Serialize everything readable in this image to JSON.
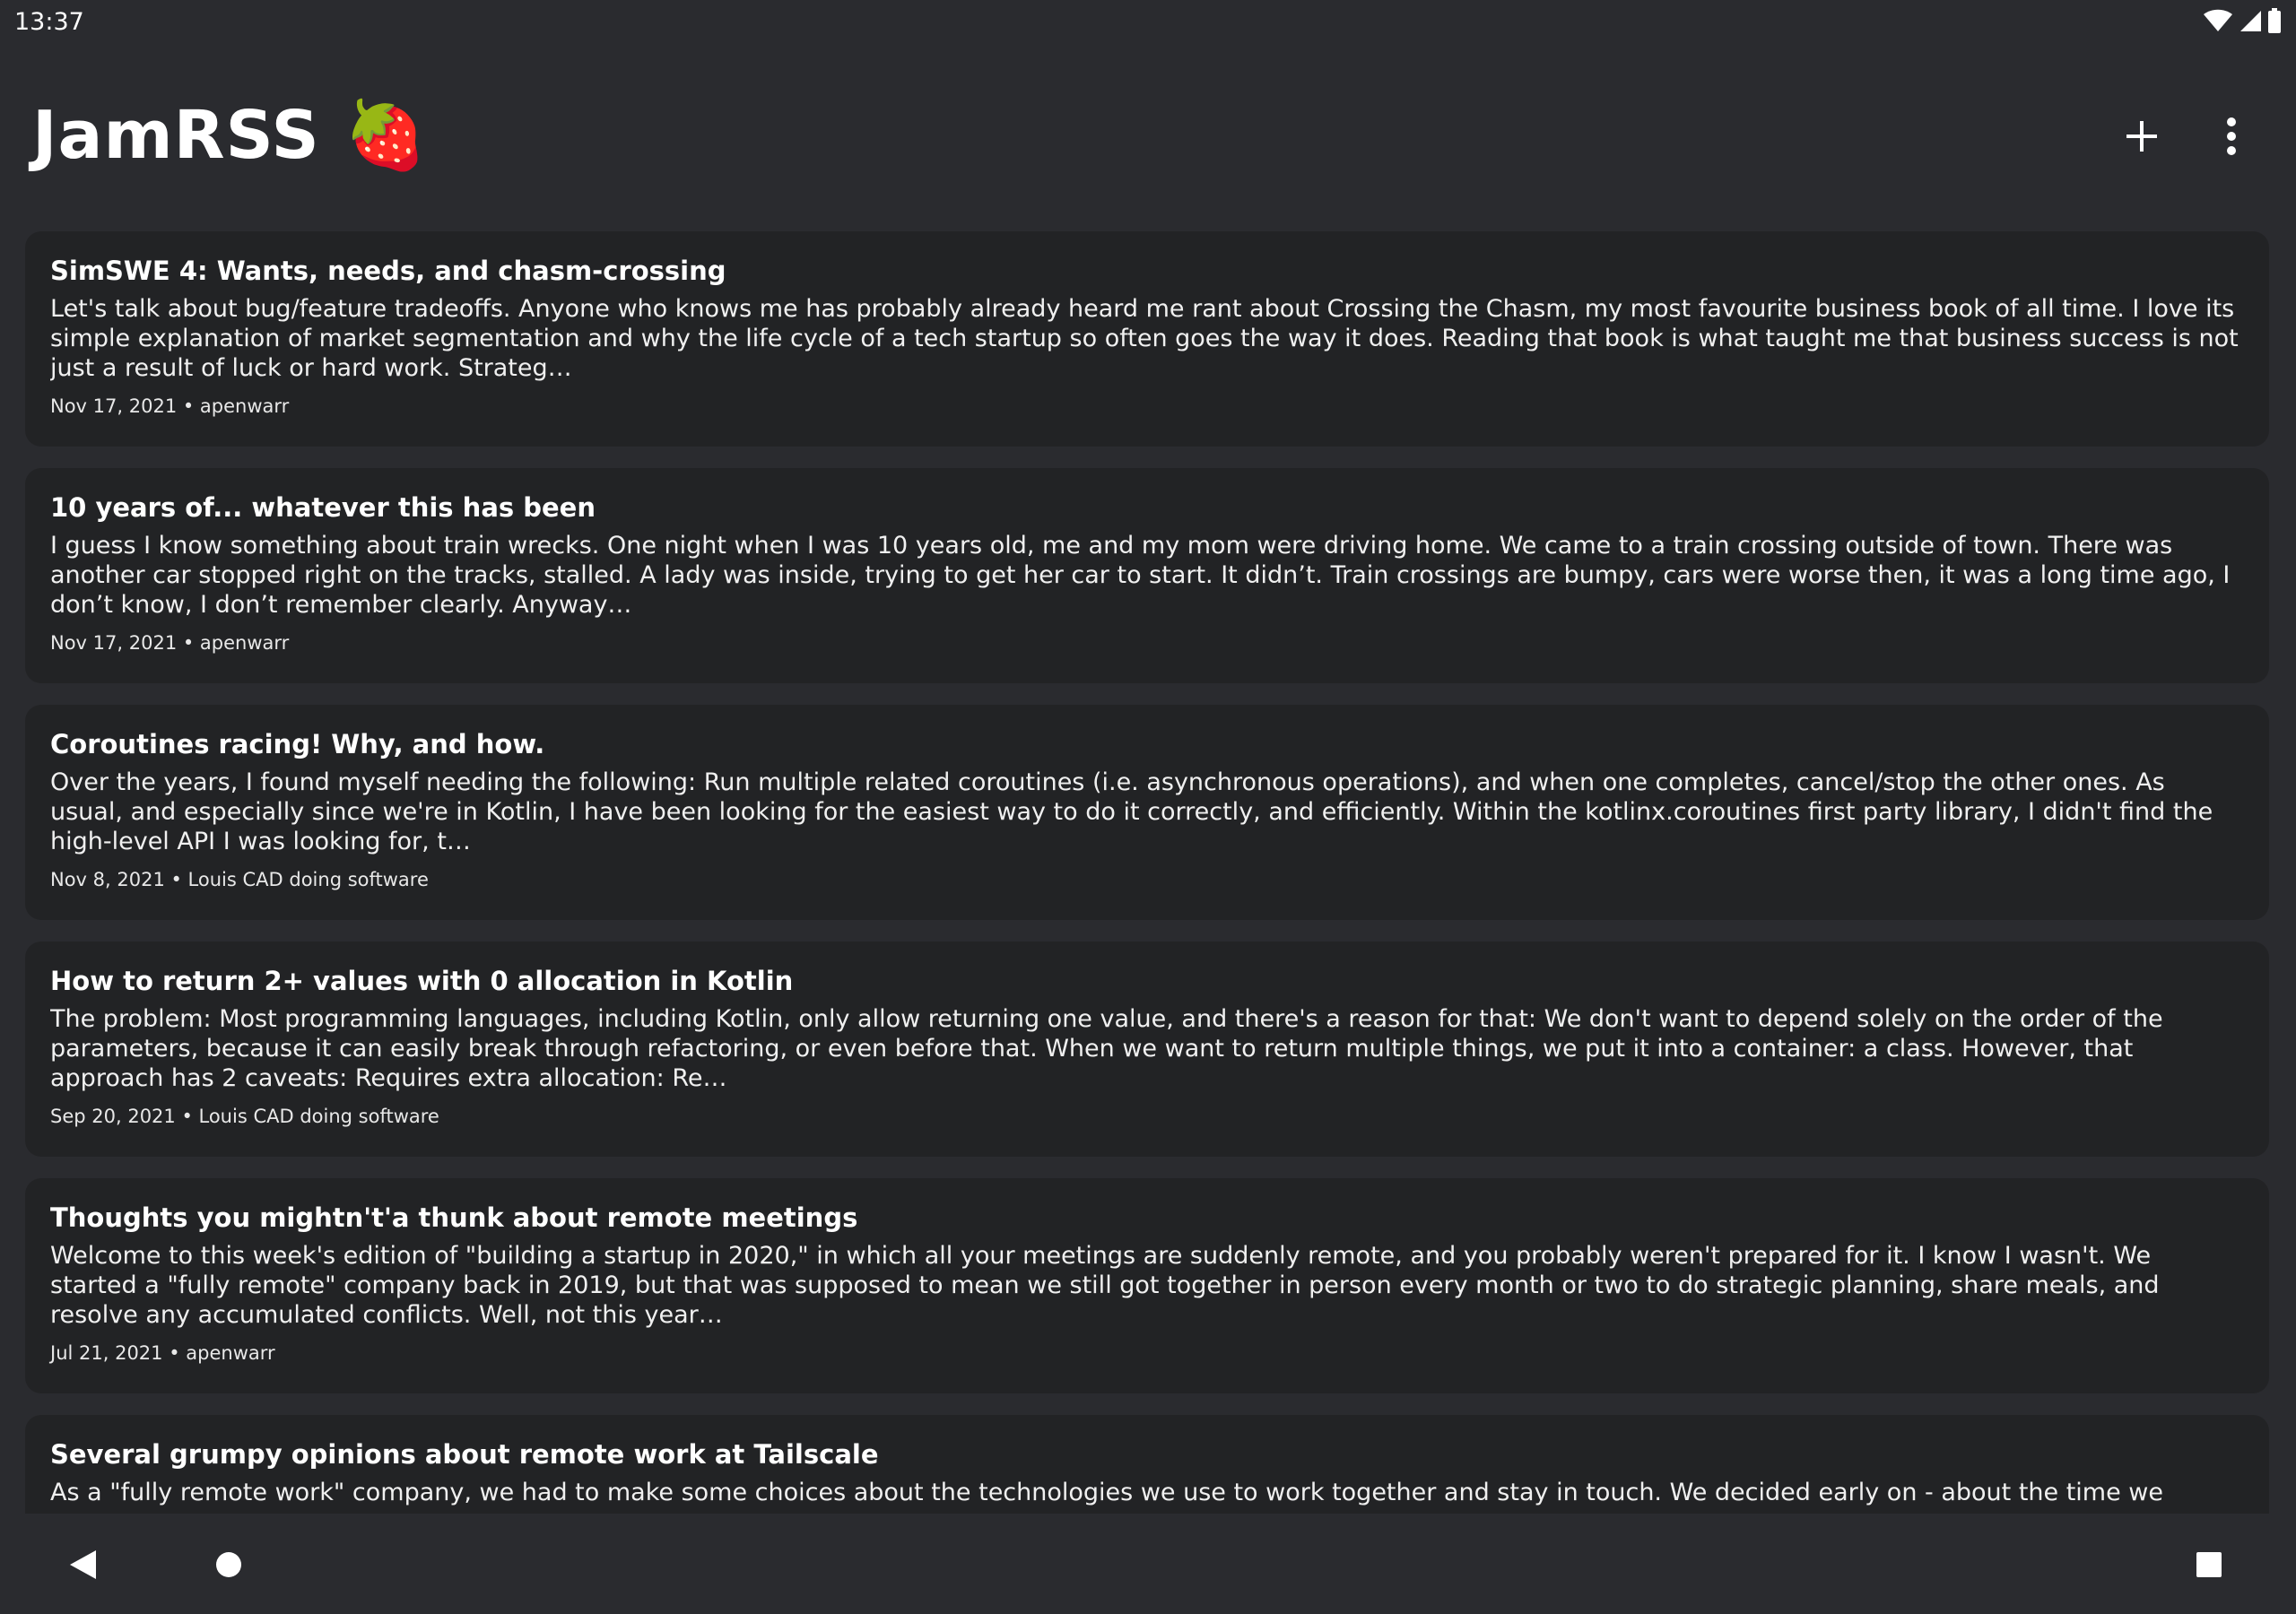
{
  "status_bar": {
    "time": "13:37"
  },
  "app_bar": {
    "title": "JamRSS 🍓",
    "add_icon": "plus-icon",
    "menu_icon": "more-vert-icon"
  },
  "articles": [
    {
      "title": "SimSWE 4: Wants, needs, and chasm-crossing",
      "excerpt": "Let's talk about bug/feature tradeoffs. Anyone who knows me has probably already heard me rant about Crossing the Chasm, my most favourite business book of all time. I love its simple explanation of market segmentation and why the life cycle of a tech startup so often goes the way it does. Reading that book is what taught me that business success is not just a result of luck or hard work. Strateg…",
      "meta": "Nov 17, 2021 • apenwarr"
    },
    {
      "title": "10 years of... whatever this has been",
      "excerpt": "I guess I know something about train wrecks. One night when I was 10 years old, me and my mom were driving home. We came to a train crossing outside of town. There was another car stopped right on the tracks, stalled. A lady was inside, trying to get her car to start. It didn’t. Train crossings are bumpy, cars were worse then, it was a long time ago, I don’t know, I don’t remember clearly. Anyway…",
      "meta": "Nov 17, 2021 • apenwarr"
    },
    {
      "title": "Coroutines racing! Why, and how.",
      "excerpt": "Over the years, I found myself needing the following: Run multiple related coroutines (i.e. asynchronous operations), and when one completes, cancel/stop the other ones. As usual, and especially since we're in Kotlin, I have been looking for the easiest way to do it correctly, and efficiently. Within the kotlinx.coroutines first party library, I didn't find the high-level API I was looking for, t…",
      "meta": "Nov 8, 2021 • Louis CAD doing software"
    },
    {
      "title": "How to return 2+ values with 0 allocation in Kotlin",
      "excerpt": "The problem: Most programming languages, including Kotlin, only allow returning one value, and there's a reason for that: We don't want to depend solely on the order of the parameters, because it can easily break through refactoring, or even before that. When we want to return multiple things, we put it into a container: a class. However, that approach has 2 caveats: Requires extra allocation: Re…",
      "meta": "Sep 20, 2021 • Louis CAD doing software"
    },
    {
      "title": "Thoughts you mightn't'a thunk about remote meetings",
      "excerpt": "Welcome to this week's edition of \"building a startup in 2020,\" in which all your meetings are suddenly remote, and you probably weren't prepared for it. I know I wasn't. We started a \"fully remote\" company back in 2019, but that was supposed to mean we still got together in person every month or two to do strategic planning, share meals, and resolve any accumulated conflicts. Well, not this year…",
      "meta": "Jul 21, 2021 • apenwarr"
    },
    {
      "title": "Several grumpy opinions about remote work at Tailscale",
      "excerpt": "As a \"fully remote work\" company, we had to make some choices about the technologies we use to work together and stay in touch. We decided early on - about the time we",
      "meta": ""
    }
  ],
  "nav_bar": {
    "back_icon": "back-triangle-icon",
    "home_icon": "home-circle-icon",
    "recents_icon": "recents-square-icon"
  }
}
